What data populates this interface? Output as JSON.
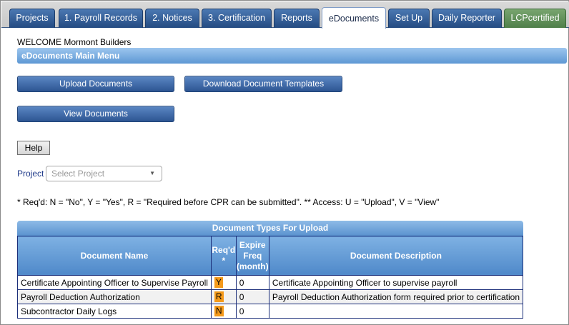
{
  "tabs": [
    {
      "label": "Projects"
    },
    {
      "label": "1. Payroll Records"
    },
    {
      "label": "2. Notices"
    },
    {
      "label": "3. Certification"
    },
    {
      "label": "Reports"
    },
    {
      "label": "eDocuments"
    },
    {
      "label": "Set Up"
    },
    {
      "label": "Daily Reporter"
    },
    {
      "label": "LCPcertified"
    }
  ],
  "welcome": "WELCOME Mormont Builders",
  "menu_title": "eDocuments Main Menu",
  "buttons": {
    "upload": "Upload Documents",
    "download_templates": "Download Document Templates",
    "view": "View Documents",
    "help": "Help"
  },
  "project": {
    "label": "Project",
    "selected": "Select Project"
  },
  "legend": "* Req'd: N = \"No\", Y = \"Yes\", R = \"Required before CPR can be submitted\". ** Access: U = \"Upload\", V = \"View\"",
  "table": {
    "title": "Document Types For Upload",
    "headers": {
      "name": "Document Name",
      "reqd": "Req'd *",
      "expire": "Expire Freq (month)",
      "desc": "Document Description"
    },
    "rows": [
      {
        "name": "Certificate Appointing Officer to Supervise Payroll",
        "reqd": "Y",
        "expire": "0",
        "desc": "Certificate Appointing Officer to supervise payroll"
      },
      {
        "name": "Payroll Deduction Authorization",
        "reqd": "R",
        "expire": "0",
        "desc": "Payroll Deduction Authorization form required prior to certification"
      },
      {
        "name": "Subcontractor Daily Logs",
        "reqd": "N",
        "expire": "0",
        "desc": ""
      }
    ]
  },
  "colors": {
    "tab_blue": "#2d5592",
    "tab_green": "#4f7f4a",
    "header_blue": "#5b93cf",
    "req_badge": "#f59a1b"
  }
}
